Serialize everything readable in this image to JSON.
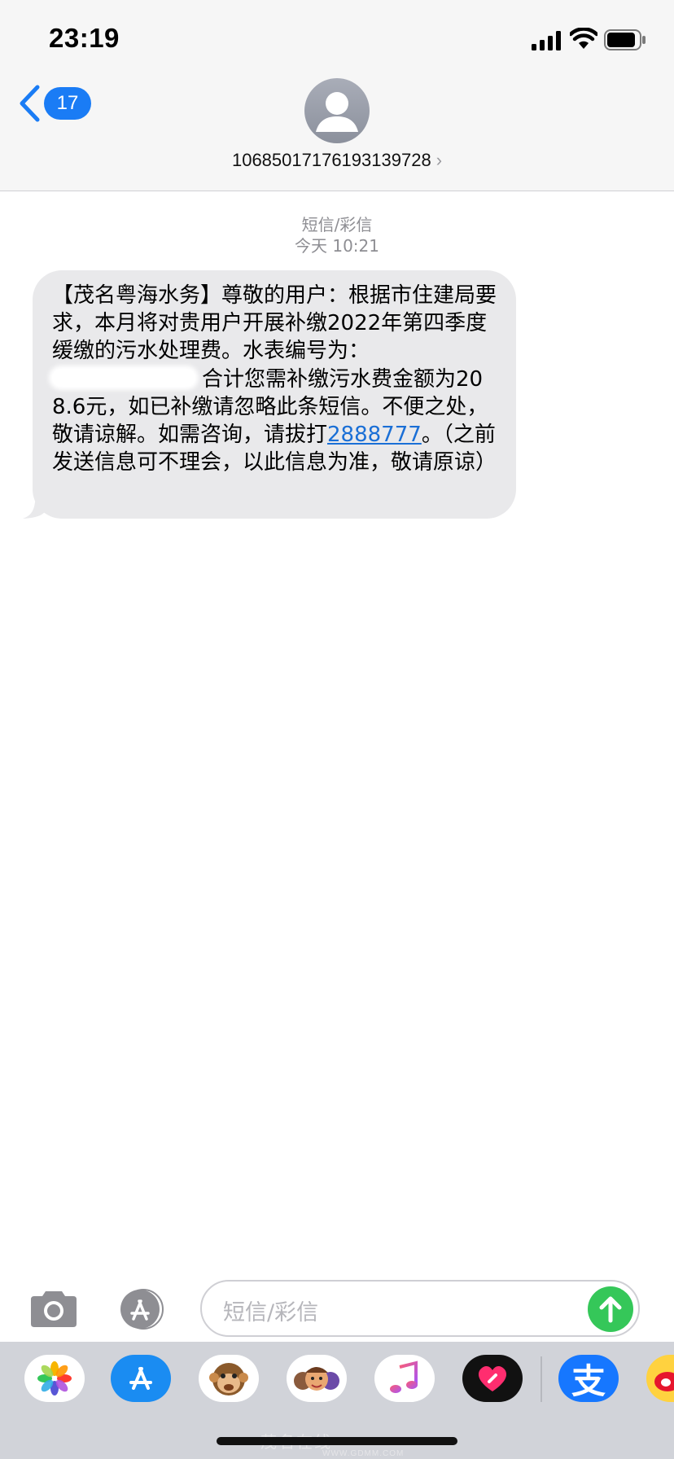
{
  "status_bar": {
    "time": "23:19"
  },
  "nav": {
    "back_badge": "17"
  },
  "contact": {
    "sender": "10685017176193139728",
    "chevron": "›"
  },
  "thread": {
    "message_type": "短信/彩信",
    "timestamp": "今天 10:21"
  },
  "message": {
    "line1": "【茂名粤海水务】尊敬的用户：根据市住建局要求，本月将对贵用户开展补缴2022年第四季度缓缴的污水处理费。水表编号为：",
    "line2": "合计您需补缴污水费金额为208.6元，如已补缴请忽略此条短信。不便之处，敬请谅解。如需咨询，请拔打",
    "phone": "2888777",
    "line3": "。（之前发送信息可不理会，以此信息为准，敬请原谅）"
  },
  "composer": {
    "placeholder": "短信/彩信"
  },
  "app_drawer": {
    "apps": [
      "photos-icon",
      "app-store-icon",
      "memoji-monkey-icon",
      "memoji-group-icon",
      "music-icon",
      "heart-app-icon",
      "alipay-icon",
      "weibo-icon"
    ],
    "alipay_glyph": "支"
  },
  "watermark": {
    "text": "茂名在线",
    "url_text": "WWW.GDMM.COM"
  },
  "colors": {
    "accent": "#1a7cf5",
    "bubble": "#e9e9eb",
    "send": "#35c759",
    "drawer": "#d1d3d9"
  }
}
